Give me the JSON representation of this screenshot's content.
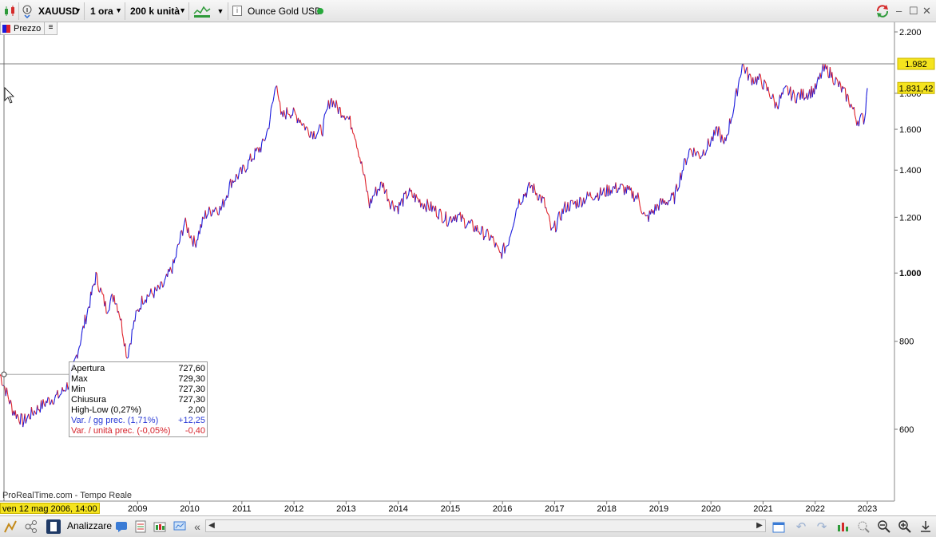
{
  "toolbar": {
    "symbol": "XAUUSD",
    "timeframe": "1 ora",
    "units": "200 k unità",
    "instrument_name": "Ounce Gold USD",
    "info_icon": "i",
    "live_status_color": "#27a83b",
    "icons": [
      "candlestick-icon",
      "info-hand-icon",
      "chart-style-icon",
      "dropdown-icon",
      "sync-icon"
    ]
  },
  "legend": {
    "label": "Prezzo",
    "list_icon": "≡"
  },
  "info_box": {
    "rows": [
      {
        "label": "Apertura",
        "value": "727,60",
        "color": "black"
      },
      {
        "label": "Max",
        "value": "729,30",
        "color": "black"
      },
      {
        "label": "Min",
        "value": "727,30",
        "color": "black"
      },
      {
        "label": "Chiusura",
        "value": "727,30",
        "color": "black"
      },
      {
        "label": "High-Low (0,27%)",
        "value": "2,00",
        "color": "black"
      },
      {
        "label": "Var. / gg prec. (1,71%)",
        "value": "+12,25",
        "color": "blue"
      },
      {
        "label": "Var. / unità prec. (-0,05%)",
        "value": "-0,40",
        "color": "red"
      }
    ]
  },
  "watermark": "ProRealTime.com - Tempo Reale",
  "crosshair_date": "ven 12 mag 2006, 14:00",
  "bottombar": {
    "analyze_label": "Analizzare",
    "collapse_glyph": "«"
  },
  "chart_data": {
    "type": "line",
    "title": "",
    "xlabel": "",
    "ylabel": "",
    "y_scale": "log",
    "ylim": [
      400,
      2250
    ],
    "x_ticks": [
      "2009",
      "2010",
      "2011",
      "2012",
      "2013",
      "2014",
      "2015",
      "2016",
      "2017",
      "2018",
      "2019",
      "2020",
      "2021",
      "2022",
      "2023"
    ],
    "y_ticks": [
      {
        "value": 2200,
        "label": "2.200",
        "bold": false
      },
      {
        "value": 1800,
        "label": "1.800",
        "bold": false
      },
      {
        "value": 1600,
        "label": "1.600",
        "bold": false
      },
      {
        "value": 1400,
        "label": "1.400",
        "bold": false
      },
      {
        "value": 1200,
        "label": "1.200",
        "bold": false
      },
      {
        "value": 1000,
        "label": "1.000",
        "bold": true
      },
      {
        "value": 800,
        "label": "800",
        "bold": false
      },
      {
        "value": 600,
        "label": "600",
        "bold": false
      }
    ],
    "crosshair_price": {
      "value": 1982,
      "label": "1.982"
    },
    "last_price": {
      "value": 1831.42,
      "label": "1.831,42"
    },
    "colors": {
      "up": "#1a1adc",
      "down": "#e0222a",
      "price_tag": "#f5e41e"
    },
    "series": [
      {
        "x": [
          2006.36,
          2006.6,
          2006.8,
          2007.0,
          2007.3,
          2007.5,
          2007.7,
          2007.9,
          2008.1,
          2008.2,
          2008.4,
          2008.55,
          2008.65,
          2008.8,
          2008.95,
          2009.1,
          2009.2,
          2009.35,
          2009.5,
          2009.7,
          2009.9,
          2010.1,
          2010.3,
          2010.5,
          2010.6,
          2010.8,
          2011.0,
          2011.2,
          2011.4,
          2011.5,
          2011.6,
          2011.67,
          2011.75,
          2011.9,
          2012.1,
          2012.25,
          2012.4,
          2012.55,
          2012.7,
          2012.85,
          2013.0,
          2013.15,
          2013.3,
          2013.45,
          2013.55,
          2013.7,
          2013.85,
          2014.0,
          2014.2,
          2014.45,
          2014.7,
          2014.95,
          2015.1,
          2015.3,
          2015.55,
          2015.8,
          2015.95,
          2016.1,
          2016.3,
          2016.55,
          2016.8,
          2016.95,
          2017.2,
          2017.45,
          2017.7,
          2017.95,
          2018.1,
          2018.3,
          2018.6,
          2018.75,
          2019.0,
          2019.3,
          2019.45,
          2019.6,
          2019.8,
          2020.0,
          2020.15,
          2020.25,
          2020.45,
          2020.6,
          2020.75,
          2020.95,
          2021.15,
          2021.25,
          2021.45,
          2021.6,
          2021.75,
          2022.0,
          2022.15,
          2022.25,
          2022.45,
          2022.65,
          2022.8,
          2022.95,
          2023.0
        ],
        "values": [
          718,
          640,
          615,
          635,
          660,
          670,
          700,
          800,
          920,
          990,
          890,
          930,
          880,
          760,
          860,
          920,
          930,
          940,
          960,
          1030,
          1180,
          1100,
          1210,
          1240,
          1230,
          1350,
          1390,
          1460,
          1520,
          1600,
          1750,
          1880,
          1660,
          1700,
          1660,
          1600,
          1580,
          1600,
          1770,
          1710,
          1680,
          1600,
          1420,
          1250,
          1300,
          1340,
          1260,
          1240,
          1300,
          1260,
          1230,
          1190,
          1210,
          1180,
          1150,
          1120,
          1060,
          1100,
          1260,
          1330,
          1260,
          1140,
          1240,
          1260,
          1290,
          1300,
          1320,
          1320,
          1280,
          1190,
          1250,
          1280,
          1400,
          1500,
          1470,
          1540,
          1600,
          1510,
          1730,
          1980,
          1890,
          1880,
          1790,
          1730,
          1820,
          1780,
          1790,
          1820,
          1940,
          1940,
          1850,
          1760,
          1650,
          1660,
          1831
        ]
      }
    ]
  }
}
